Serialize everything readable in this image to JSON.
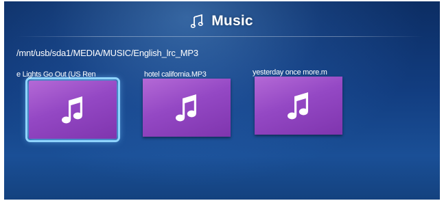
{
  "header": {
    "title": "Music",
    "icon": "music-note-icon"
  },
  "browser": {
    "path": "/mnt/usb/sda1/MEDIA/MUSIC/English_lrc_MP3"
  },
  "files": [
    {
      "label": "e Lights Go Out (US Ren",
      "icon": "music-note-icon",
      "selected": true
    },
    {
      "label": "hotel california.MP3",
      "icon": "music-note-icon",
      "selected": false
    },
    {
      "label": "yesterday once more.m",
      "icon": "music-note-icon",
      "selected": false
    }
  ],
  "colors": {
    "background": "#123d80",
    "tile": "#9448c4",
    "selection": "#8fd4ff"
  }
}
